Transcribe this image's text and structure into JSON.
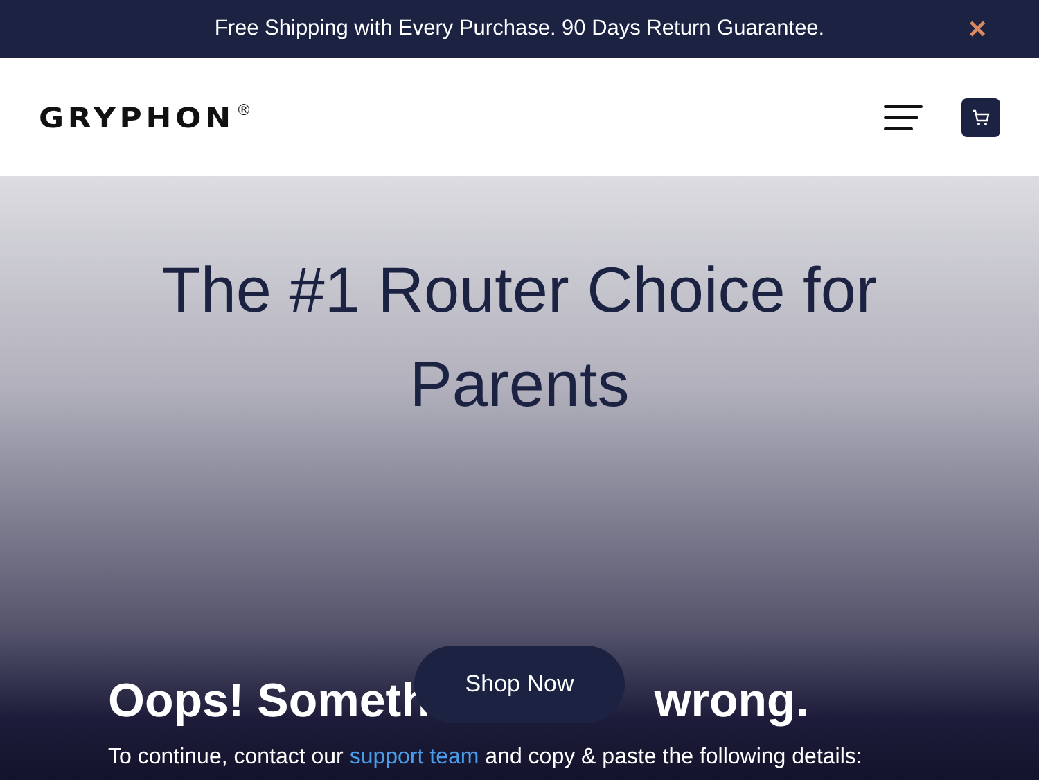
{
  "announcement": {
    "text": "Free Shipping with Every Purchase. 90 Days Return Guarantee.",
    "close": "×"
  },
  "header": {
    "logo": "GRYPHON",
    "logo_mark": "®"
  },
  "hero": {
    "headline": "The #1 Router Choice for Parents",
    "button": "Shop Now",
    "video_error": {
      "heading_start": "Oops! Someth",
      "heading_end": "wrong.",
      "message_before": "To continue, contact our ",
      "link": "support team",
      "message_after": " and copy & paste the following details:"
    }
  }
}
